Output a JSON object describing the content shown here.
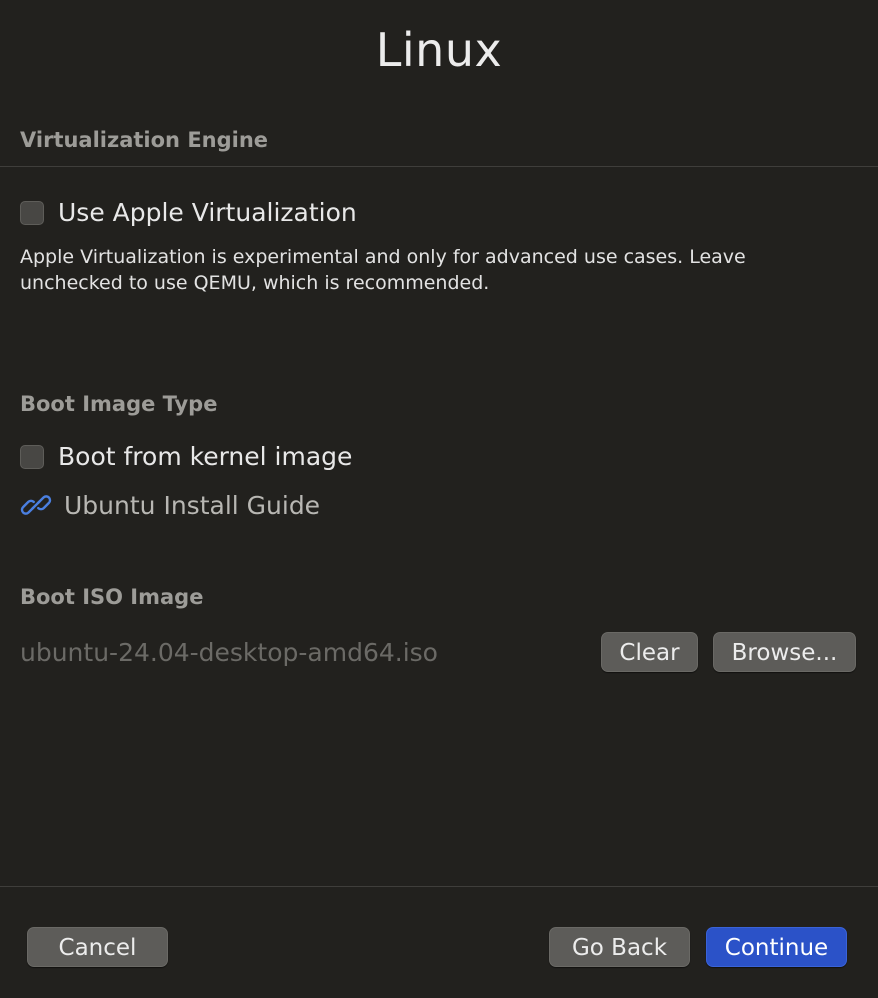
{
  "window": {
    "title": "Linux"
  },
  "virtualization": {
    "section_label": "Virtualization Engine",
    "apple_virtualization_label": "Use Apple Virtualization",
    "apple_virtualization_checked": false,
    "help_text": "Apple Virtualization is experimental and only for advanced use cases. Leave unchecked to use QEMU, which is recommended."
  },
  "boot_image_type": {
    "section_label": "Boot Image Type",
    "kernel_image_label": "Boot from kernel image",
    "kernel_image_checked": false,
    "guide_link_label": "Ubuntu Install Guide",
    "guide_link_icon": "link-icon"
  },
  "boot_iso": {
    "section_label": "Boot ISO Image",
    "file_name": "ubuntu-24.04-desktop-amd64.iso",
    "clear_label": "Clear",
    "browse_label": "Browse..."
  },
  "footer": {
    "cancel_label": "Cancel",
    "go_back_label": "Go Back",
    "continue_label": "Continue"
  },
  "colors": {
    "background": "#22211e",
    "primary_button": "#2b52c8",
    "link_icon": "#4a7fe0"
  }
}
